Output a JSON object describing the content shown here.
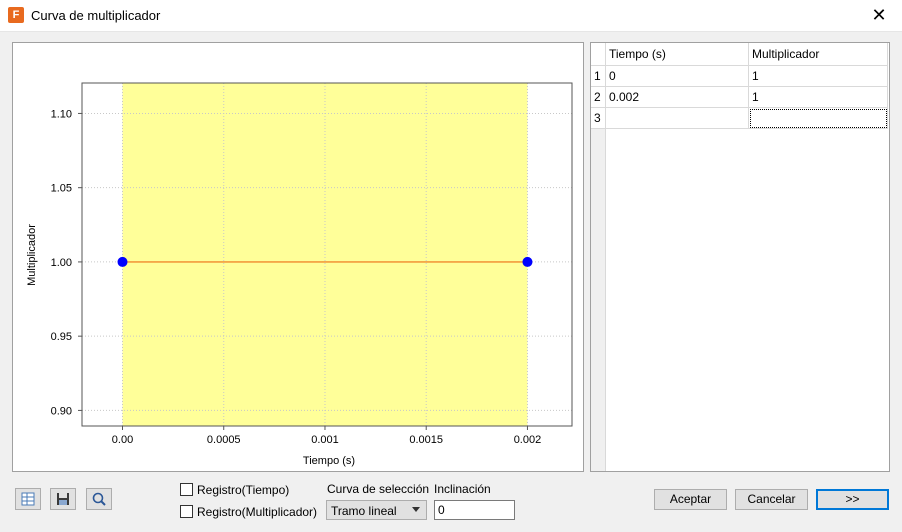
{
  "window": {
    "title": "Curva de multiplicador",
    "icon_letter": "F"
  },
  "table": {
    "headers": [
      "Tiempo (s)",
      "Multiplicador"
    ],
    "rows": [
      {
        "num": "1",
        "time": "0",
        "mult": "1"
      },
      {
        "num": "2",
        "time": "0.002",
        "mult": "1"
      },
      {
        "num": "3",
        "time": "",
        "mult": ""
      }
    ]
  },
  "chart_data": {
    "type": "line",
    "x": [
      0.0,
      0.002
    ],
    "y": [
      1.0,
      1.0
    ],
    "xlabel": "Tiempo (s)",
    "ylabel": "Multiplicador",
    "xlim": [
      -0.0002,
      0.00222
    ],
    "ylim": [
      0.8895,
      1.1205
    ],
    "xticks": [
      0.0,
      0.0005,
      0.001,
      0.0015,
      0.002
    ],
    "xtick_labels": [
      "0.00",
      "0.0005",
      "0.001",
      "0.0015",
      "0.002"
    ],
    "yticks": [
      0.9,
      0.95,
      1.0,
      1.05,
      1.1
    ],
    "ytick_labels": [
      "0.90",
      "0.95",
      "1.00",
      "1.05",
      "1.10"
    ],
    "grid": true,
    "highlight_range": [
      0.0,
      0.002
    ],
    "colors": {
      "highlight": "#ffff99",
      "line": "#f39c3c",
      "point": "#0000ff"
    }
  },
  "controls": {
    "log_time_label": "Registro(Tiempo)",
    "log_mult_label": "Registro(Multiplicador)",
    "curve_label": "Curva de selección",
    "curve_value": "Tramo lineal",
    "slope_label": "Inclinación",
    "slope_value": "0"
  },
  "buttons": {
    "accept": "Aceptar",
    "cancel": "Cancelar",
    "more": ">>"
  },
  "toolbar": {
    "icons": [
      "table-icon",
      "save-icon",
      "zoom-icon"
    ]
  }
}
